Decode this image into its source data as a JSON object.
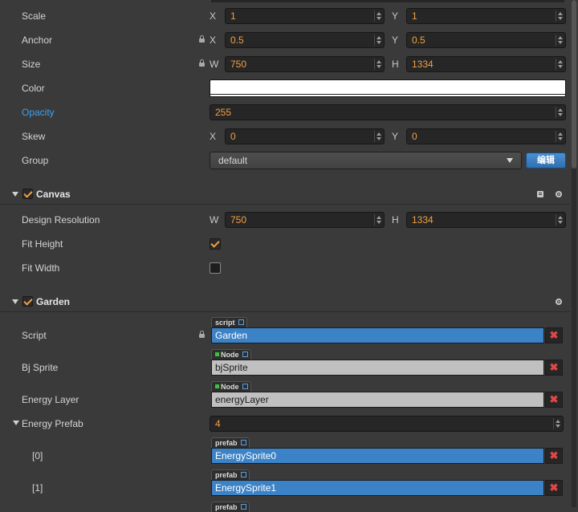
{
  "node": {
    "scale": {
      "label": "Scale",
      "x_axis": "X",
      "x": "1",
      "y_axis": "Y",
      "y": "1"
    },
    "anchor": {
      "label": "Anchor",
      "x_axis": "X",
      "x": "0.5",
      "y_axis": "Y",
      "y": "0.5"
    },
    "size": {
      "label": "Size",
      "w_axis": "W",
      "w": "750",
      "h_axis": "H",
      "h": "1334"
    },
    "color": {
      "label": "Color",
      "value": "#ffffff"
    },
    "opacity": {
      "label": "Opacity",
      "value": "255"
    },
    "skew": {
      "label": "Skew",
      "x_axis": "X",
      "x": "0",
      "y_axis": "Y",
      "y": "0"
    },
    "group": {
      "label": "Group",
      "value": "default",
      "edit_button": "编辑"
    }
  },
  "canvas": {
    "title": "Canvas",
    "enabled": true,
    "design_resolution": {
      "label": "Design Resolution",
      "w_axis": "W",
      "w": "750",
      "h_axis": "H",
      "h": "1334"
    },
    "fit_height": {
      "label": "Fit Height",
      "checked": true
    },
    "fit_width": {
      "label": "Fit Width",
      "checked": false
    }
  },
  "garden": {
    "title": "Garden",
    "enabled": true,
    "script": {
      "label": "Script",
      "tag": "script",
      "value": "Garden"
    },
    "bj_sprite": {
      "label": "Bj Sprite",
      "tag": "Node",
      "value": "bjSprite"
    },
    "energy_layer": {
      "label": "Energy Layer",
      "tag": "Node",
      "value": "energyLayer"
    },
    "energy_prefab": {
      "label": "Energy Prefab",
      "count": "4",
      "items": [
        {
          "index": "[0]",
          "tag": "prefab",
          "value": "EnergySprite0"
        },
        {
          "index": "[1]",
          "tag": "prefab",
          "value": "EnergySprite1"
        },
        {
          "index": "",
          "tag": "prefab",
          "value": ""
        }
      ]
    }
  },
  "icons": {
    "lock": "lock-icon",
    "gear": "gear-icon",
    "book": "help-book-icon",
    "external": "external-link-icon",
    "remove": "remove-icon"
  },
  "colors": {
    "accent_orange": "#f0a044",
    "highlight_blue": "#3fa0f0",
    "ref_blue": "#3c82c6",
    "remove_red": "#e04848"
  }
}
